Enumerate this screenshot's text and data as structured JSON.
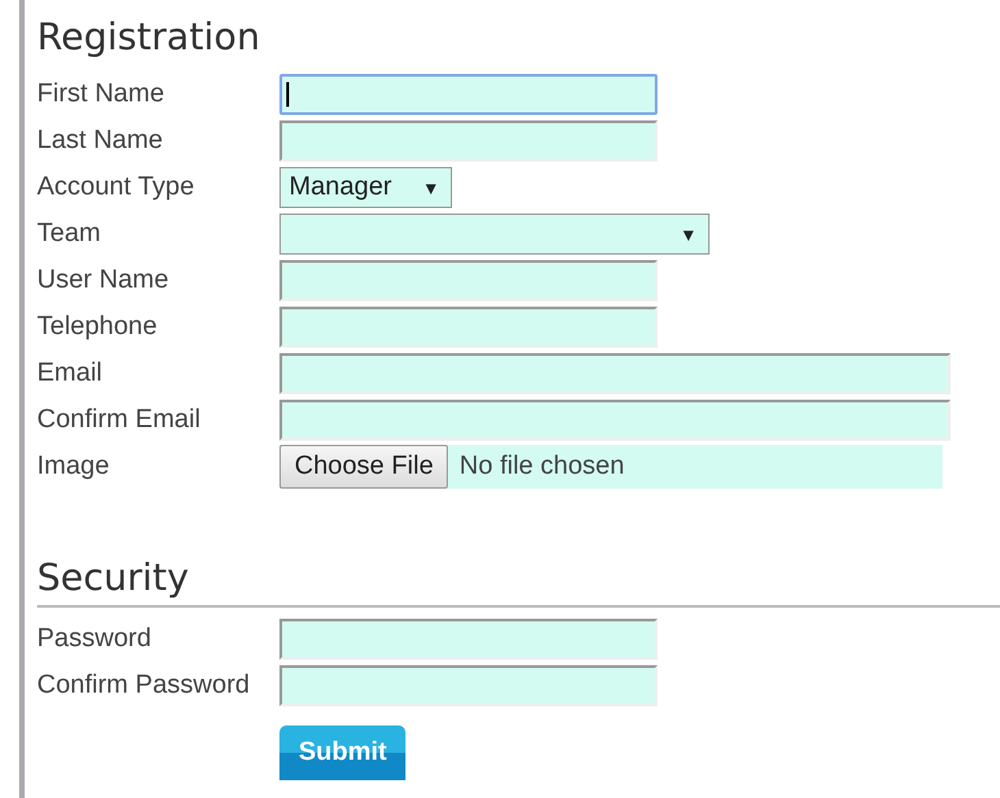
{
  "sections": [
    {
      "title": "Registration",
      "divider": false,
      "rows": [
        {
          "label": "First Name",
          "kind": "text",
          "focused": true
        },
        {
          "label": "Last Name",
          "kind": "text",
          "focused": false
        },
        {
          "label": "Account Type",
          "kind": "select",
          "value": "Manager",
          "arrow": "▼"
        },
        {
          "label": "Team",
          "kind": "wideselect",
          "arrow": "▼"
        },
        {
          "label": "User Name",
          "kind": "text",
          "focused": false
        },
        {
          "label": "Telephone",
          "kind": "text",
          "focused": false
        },
        {
          "label": "Email",
          "kind": "longtext",
          "focused": false
        },
        {
          "label": "Confirm Email",
          "kind": "longtext",
          "focused": false
        },
        {
          "label": "Image",
          "kind": "file",
          "button": "Choose File",
          "status": "No file chosen"
        }
      ]
    },
    {
      "title": "Security",
      "divider": true,
      "rows": [
        {
          "label": "Password",
          "kind": "text",
          "focused": false
        },
        {
          "label": "Confirm Password",
          "kind": "text",
          "focused": false
        }
      ]
    }
  ],
  "submit": "Submit"
}
